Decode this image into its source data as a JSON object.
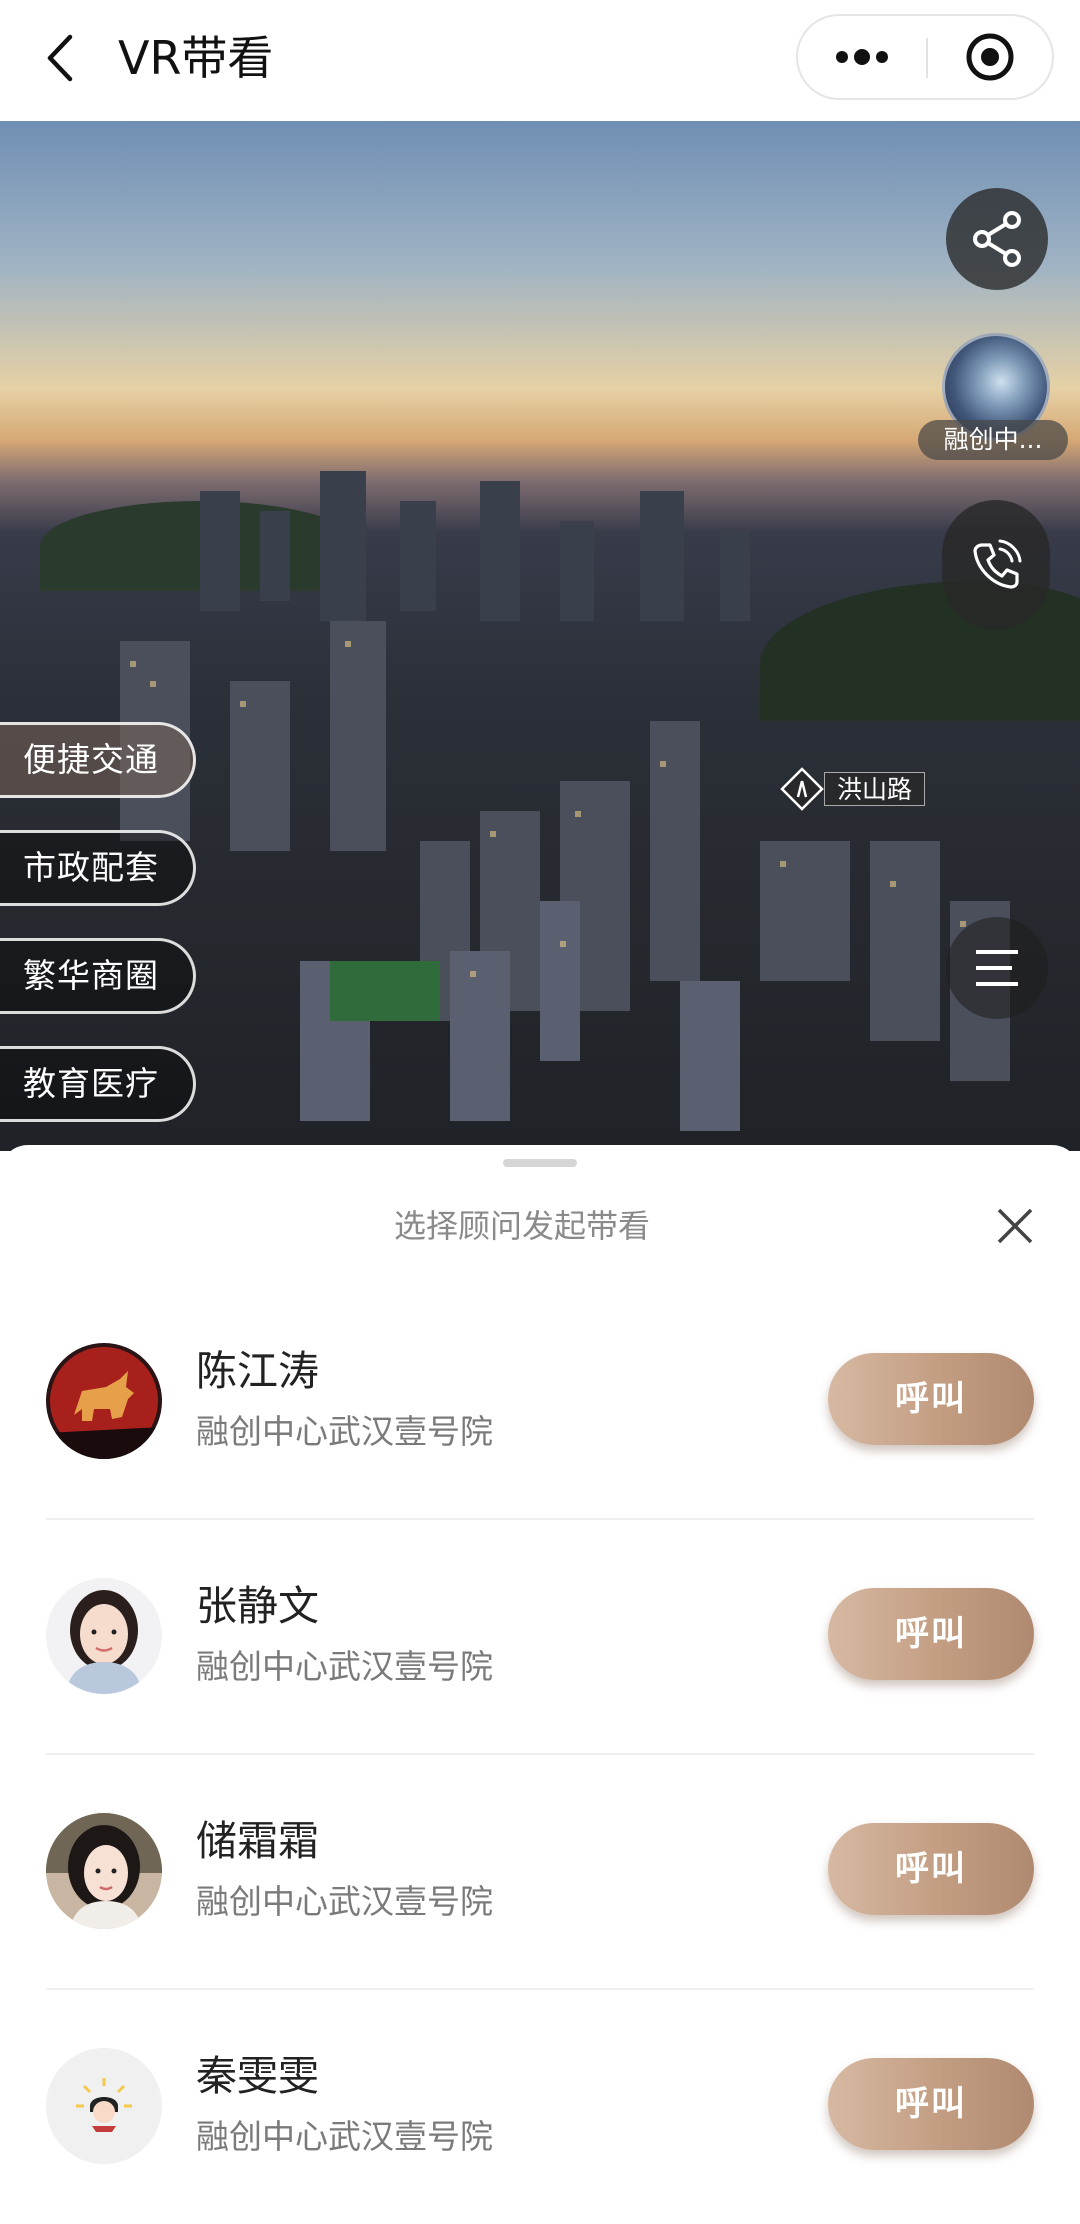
{
  "header": {
    "title": "VR带看"
  },
  "scene": {
    "project_name": "融创中...",
    "poi_menu": [
      {
        "label": "便捷交通",
        "active": true
      },
      {
        "label": "市政配套",
        "active": false
      },
      {
        "label": "繁华商圈",
        "active": false
      },
      {
        "label": "教育医疗",
        "active": false
      }
    ],
    "road_label": "洪山路"
  },
  "sheet": {
    "title": "选择顾问发起带看",
    "consultants": [
      {
        "name": "陈江涛",
        "project": "融创中心武汉壹号院",
        "call_label": "呼叫"
      },
      {
        "name": "张静文",
        "project": "融创中心武汉壹号院",
        "call_label": "呼叫"
      },
      {
        "name": "储霜霜",
        "project": "融创中心武汉壹号院",
        "call_label": "呼叫"
      },
      {
        "name": "秦雯雯",
        "project": "融创中心武汉壹号院",
        "call_label": "呼叫"
      }
    ]
  },
  "colors": {
    "accent": "#c29d82",
    "title_text": "#111111",
    "muted_text": "#7a7a7a"
  }
}
